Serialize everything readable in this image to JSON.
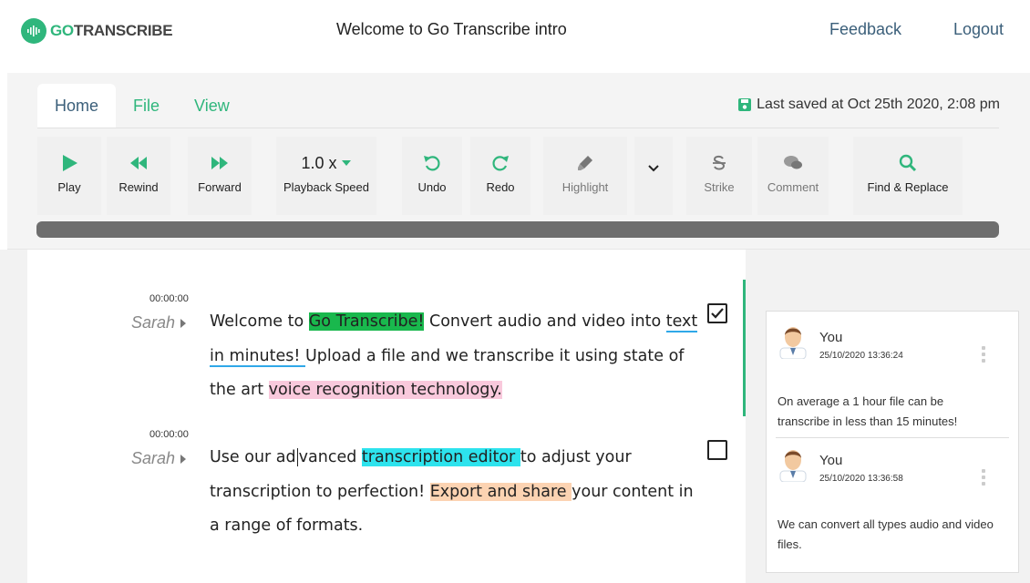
{
  "header": {
    "logo_go": "GO",
    "logo_rest": "TRANSCRIBE",
    "title": "Welcome to Go Transcribe intro",
    "feedback": "Feedback",
    "logout": "Logout"
  },
  "tabs": [
    "Home",
    "File",
    "View"
  ],
  "saved_text": "Last saved at Oct 25th 2020, 2:08 pm",
  "tools": {
    "play": "Play",
    "rewind": "Rewind",
    "forward": "Forward",
    "speed_value": "1.0 x",
    "speed_label": "Playback Speed",
    "undo": "Undo",
    "redo": "Redo",
    "highlight": "Highlight",
    "strike": "Strike",
    "comment": "Comment",
    "find": "Find & Replace"
  },
  "colors": {
    "brand": "#2fb67c",
    "link": "#3b5f7a",
    "highlight_green": "#19b84d",
    "highlight_pink": "#f9c9dc",
    "highlight_cyan": "#2de3ed",
    "highlight_orange": "#fcd3b2",
    "comment_underline": "#2fa8e8"
  },
  "segments": [
    {
      "timestamp": "00:00:00",
      "speaker": "Sarah",
      "checked": true,
      "parts": {
        "p1": "Welcome to ",
        "p2": "Go Transcribe!",
        "p3": " Convert audio and video into ",
        "p4": "text in minutes! ",
        "p5": " Upload a file and we transcribe it using state of the art ",
        "p6": "voice recognition technology."
      }
    },
    {
      "timestamp": "00:00:00",
      "speaker": "Sarah",
      "checked": false,
      "parts": {
        "p1": "Use our ad",
        "p2": "vanced ",
        "p3": "transcription editor ",
        "p4": "to adjust your transcription to perfection! ",
        "p5": "Export and share ",
        "p6": "your content in a range of formats."
      }
    }
  ],
  "comments": [
    {
      "author": "You",
      "time": "25/10/2020 13:36:24",
      "text": "On average a 1 hour file can be transcribe in less than 15 minutes!"
    },
    {
      "author": "You",
      "time": "25/10/2020 13:36:58",
      "text": "We can convert all types audio and video files."
    }
  ]
}
